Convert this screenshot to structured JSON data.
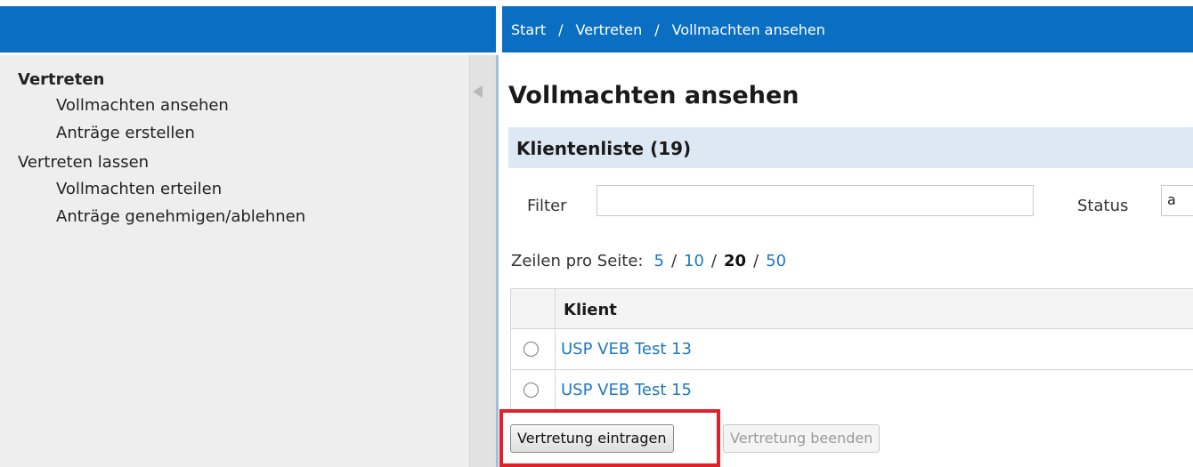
{
  "breadcrumb": {
    "items": [
      "Start",
      "Vertreten",
      "Vollmachten ansehen"
    ],
    "separator": "/"
  },
  "sidebar": {
    "items": [
      {
        "label": "Vertreten",
        "level": 0,
        "bold": true
      },
      {
        "label": "Vollmachten ansehen",
        "level": 1
      },
      {
        "label": "Anträge erstellen",
        "level": 1
      },
      {
        "label": "Vertreten lassen",
        "level": 0
      },
      {
        "label": "Vollmachten erteilen",
        "level": 1
      },
      {
        "label": "Anträge genehmigen/ablehnen",
        "level": 1
      }
    ]
  },
  "main": {
    "title": "Vollmachten ansehen",
    "section_title": "Klientenliste (19)",
    "filter": {
      "label": "Filter",
      "value": ""
    },
    "status": {
      "label": "Status",
      "value": "a"
    },
    "rows_per_page": {
      "label": "Zeilen pro Seite:",
      "options": [
        "5",
        "10",
        "20",
        "50"
      ],
      "current": "20",
      "separator": "/"
    },
    "table": {
      "columns": [
        "Klient"
      ],
      "rows": [
        {
          "klient": "USP VEB Test 13"
        },
        {
          "klient": "USP VEB Test 15"
        }
      ]
    },
    "buttons": {
      "primary": "Vertretung eintragen",
      "secondary": "Vertretung beenden"
    }
  },
  "colors": {
    "topbar": "#0a6fc2",
    "link": "#1e79bd",
    "section_header": "#dde8f5",
    "highlight": "#e0202a"
  }
}
